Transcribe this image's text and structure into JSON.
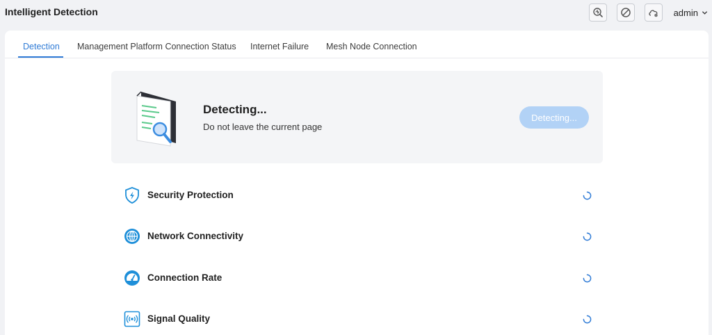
{
  "app": {
    "title": "Intelligent Detection"
  },
  "header": {
    "buttons": [
      {
        "icon": "diagnose-icon"
      },
      {
        "icon": "disable-icon"
      },
      {
        "icon": "cloud-icon"
      }
    ],
    "user": {
      "name": "admin",
      "icon": "chevron-down-icon"
    }
  },
  "tabs": [
    {
      "label": "Detection",
      "active": true
    },
    {
      "label": "Management Platform Connection Status",
      "active": false
    },
    {
      "label": "Internet Failure",
      "active": false
    },
    {
      "label": "Mesh Node Connection",
      "active": false
    }
  ],
  "detection": {
    "title": "Detecting...",
    "subtitle": "Do not leave the current page",
    "button_label": "Detecting..."
  },
  "checks": [
    {
      "label": "Security Protection",
      "icon": "shield-icon",
      "status": "loading"
    },
    {
      "label": "Network Connectivity",
      "icon": "globe-icon",
      "status": "loading"
    },
    {
      "label": "Connection Rate",
      "icon": "speedometer-icon",
      "status": "loading"
    },
    {
      "label": "Signal Quality",
      "icon": "signal-icon",
      "status": "loading"
    }
  ],
  "colors": {
    "accent": "#2f7bd6",
    "button_disabled": "#b2d2f6",
    "icon_blue": "#1e8fd9"
  }
}
